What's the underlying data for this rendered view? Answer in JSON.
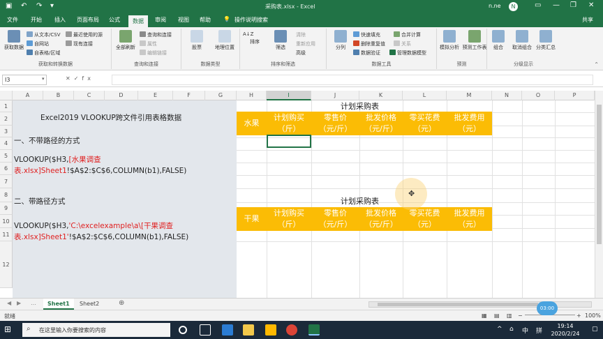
{
  "titlebar": {
    "title": "采购表.xlsx - Excel",
    "user": "n.ne",
    "avatar": "N",
    "icons": {
      "save": "save-icon",
      "undo": "undo-icon",
      "redo": "redo-icon",
      "minimize": "minimize-icon",
      "restore": "restore-icon",
      "close": "close-icon"
    }
  },
  "tabs": {
    "items": [
      "文件",
      "开始",
      "插入",
      "页面布局",
      "公式",
      "数据",
      "审阅",
      "视图",
      "帮助"
    ],
    "active": "数据",
    "search": "操作说明搜索",
    "share": "共享"
  },
  "ribbon": {
    "group1": {
      "big": "获取数据",
      "items": [
        "从文本/CSV",
        "自网站",
        "自表格/区域"
      ],
      "recent": [
        "最近使用的源",
        "现有连接"
      ],
      "label": "获取和转换数据"
    },
    "group2": {
      "big": "全部刷新",
      "items": [
        "查询和连接",
        "属性",
        "编辑链接"
      ],
      "label": "查询和连接"
    },
    "group3": {
      "big": "股票",
      "big2": "地理位置",
      "label": "数据类型"
    },
    "group4": {
      "items": [
        "排序",
        "筛选",
        "清除",
        "重新应用",
        "高级"
      ],
      "label": "排序和筛选"
    },
    "group5": {
      "big": "分列",
      "items": [
        "快速填充",
        "删除重复值",
        "数据验证",
        "合并计算",
        "关系",
        "管理数据模型"
      ],
      "label": "数据工具"
    },
    "group6": {
      "items": [
        "模拟分析",
        "预测工作表"
      ],
      "label": "预测"
    },
    "group7": {
      "items": [
        "组合",
        "取消组合",
        "分类汇总"
      ],
      "label": "分级显示"
    }
  },
  "formula_bar": {
    "name_box": "I3",
    "formula": "",
    "icons": [
      "cancel-icon",
      "confirm-icon",
      "fx-icon"
    ]
  },
  "columns": [
    "A",
    "B",
    "C",
    "D",
    "E",
    "F",
    "G",
    "H",
    "I",
    "J",
    "K",
    "L",
    "M",
    "N",
    "O",
    "P"
  ],
  "selected_column": "I",
  "rows": [
    "1",
    "2",
    "3",
    "4",
    "5",
    "6",
    "7",
    "8",
    "9",
    "10",
    "11",
    "12"
  ],
  "left_text": {
    "title": "Excel2019 VLOOKUP跨文件引用表格数据",
    "section1": "一、不带路径的方式",
    "formula1_a": "VLOOKUP($H3,",
    "formula1_b": "[水果调查",
    "formula1_c": "表.xlsx]Sheet1",
    "formula1_d": "!$A$2:$C$6,COLUMN(b1),FALSE)",
    "section2": "二、带路径方式",
    "formula2_a": "VLOOKUP($H3,",
    "formula2_b": "'C:\\excelexample\\a\\[干果调查",
    "formula2_c": "表.xlsx]Sheet1'",
    "formula2_d": "!$A$2:$C$6,COLUMN(b1),FALSE)"
  },
  "table1": {
    "title": "计划采购表",
    "headers": [
      {
        "l1": "水果",
        "l2": ""
      },
      {
        "l1": "计划购买",
        "l2": "（斤）"
      },
      {
        "l1": "零售价",
        "l2": "（元/斤）"
      },
      {
        "l1": "批发价格",
        "l2": "（元/斤）"
      },
      {
        "l1": "零买花费",
        "l2": "（元）"
      },
      {
        "l1": "批发费用",
        "l2": "（元）"
      }
    ]
  },
  "table2": {
    "title": "计划采购表",
    "headers": [
      {
        "l1": "干果",
        "l2": ""
      },
      {
        "l1": "计划购买",
        "l2": "（斤）"
      },
      {
        "l1": "零售价",
        "l2": "（元/斤）"
      },
      {
        "l1": "批发价格",
        "l2": "（元/斤）"
      },
      {
        "l1": "零买花费",
        "l2": "（元）"
      },
      {
        "l1": "批发费用",
        "l2": "（元）"
      }
    ]
  },
  "sheets": [
    "Sheet1",
    "Sheet2"
  ],
  "active_sheet": "Sheet1",
  "status": {
    "ready": "就绪",
    "zoom": "100%",
    "badge": "03:00"
  },
  "taskbar": {
    "search_placeholder": "在这里输入你要搜索的内容",
    "time": "19:14",
    "date": "2020/2/24",
    "ime": "中",
    "lang": "拼"
  },
  "colors": {
    "excel_green": "#217346",
    "header_orange": "#fbbc05",
    "red_text": "#e02020"
  }
}
